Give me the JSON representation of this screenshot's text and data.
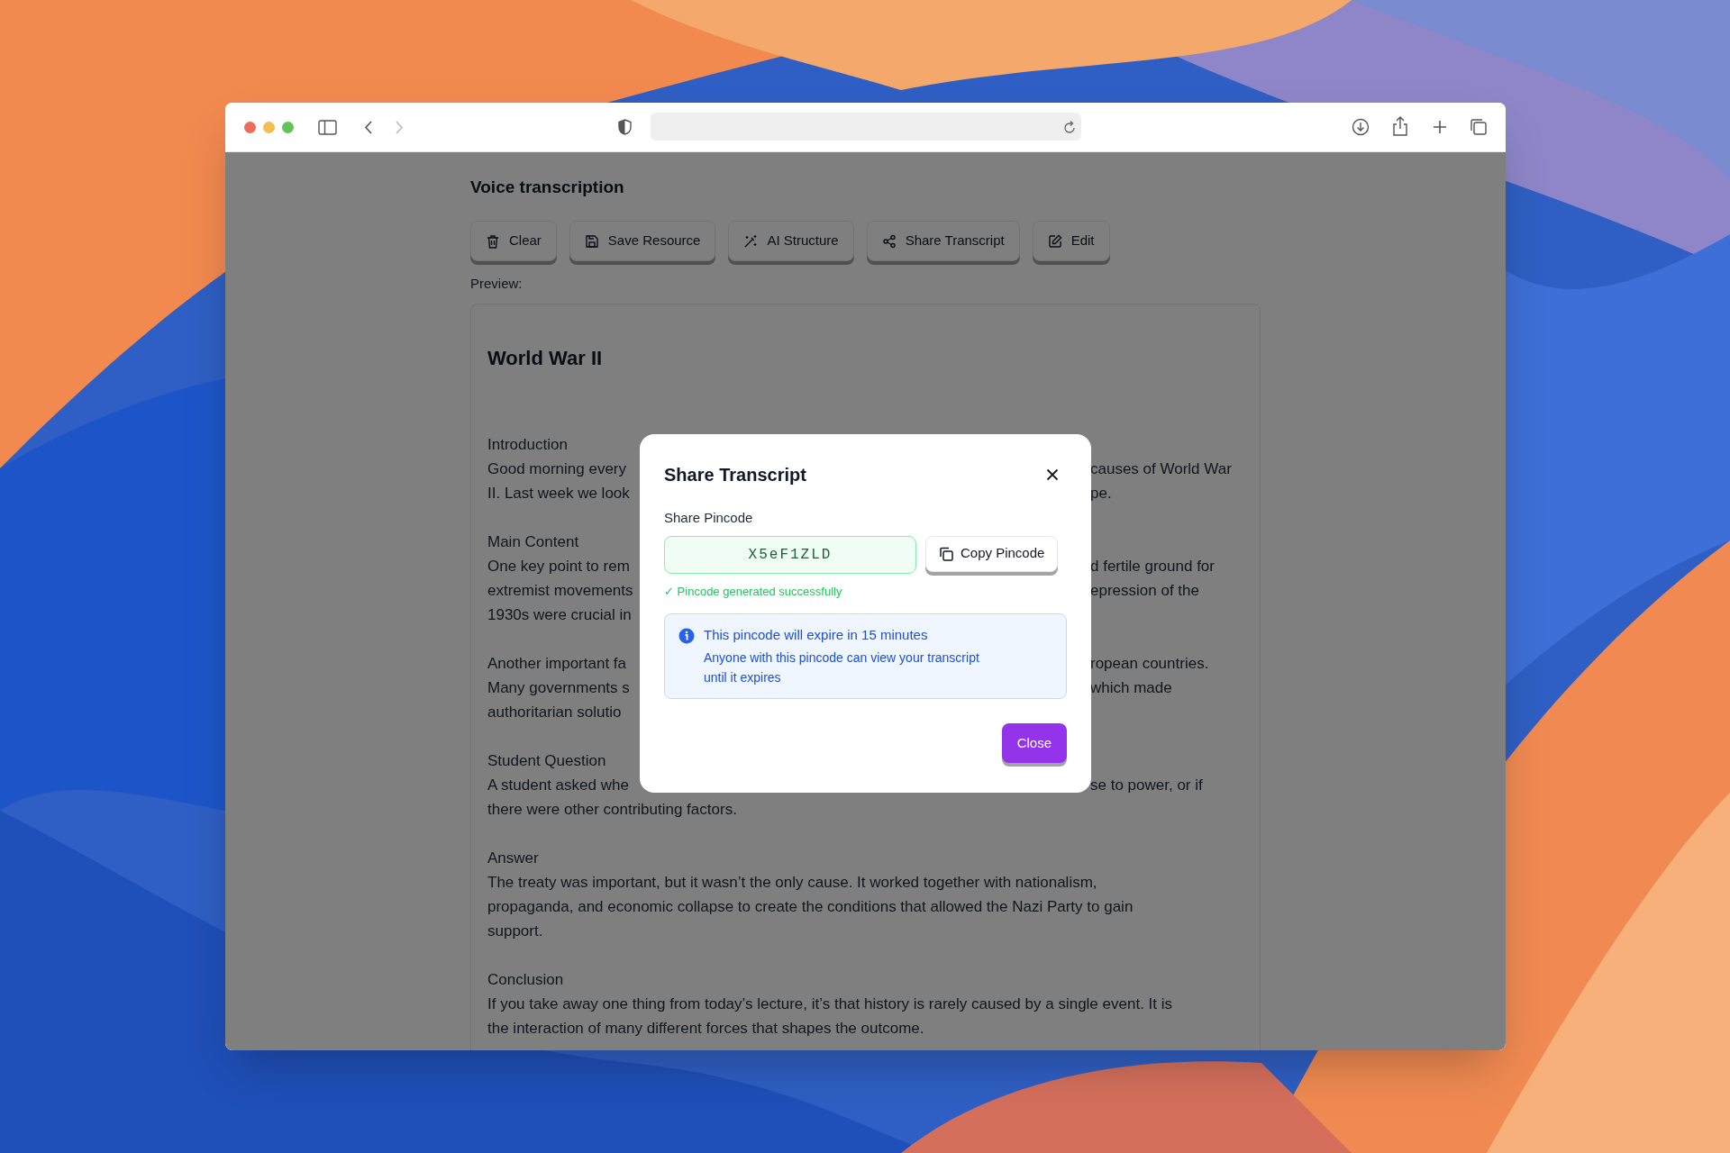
{
  "page": {
    "title": "Voice transcription",
    "toolbar_buttons": [
      {
        "label": "Clear"
      },
      {
        "label": "Save Resource"
      },
      {
        "label": "AI Structure"
      },
      {
        "label": "Share Transcript"
      },
      {
        "label": "Edit"
      }
    ],
    "preview_label": "Preview:",
    "preview": {
      "title": "World War II",
      "paragraphs": [
        [
          {
            "kind": "full",
            "text": "Introduction"
          },
          {
            "kind": "split",
            "left": "Good morning every",
            "right": "causes of World War"
          },
          {
            "kind": "split",
            "left": "II. Last week we look",
            "right": "pe."
          }
        ],
        [
          {
            "kind": "full",
            "text": "Main Content"
          },
          {
            "kind": "split",
            "left": "One key point to rem",
            "right": "d fertile ground for"
          },
          {
            "kind": "split",
            "left": "extremist movements",
            "right": "epression of the"
          },
          {
            "kind": "split",
            "left": "1930s were crucial in"
          }
        ],
        [
          {
            "kind": "split",
            "left": "Another important fa",
            "right": "ropean countries."
          },
          {
            "kind": "split",
            "left": "Many governments s",
            "right": "which made"
          },
          {
            "kind": "split",
            "left": "authoritarian solutio"
          }
        ],
        [
          {
            "kind": "full",
            "text": "Student Question"
          },
          {
            "kind": "split",
            "left": "A student asked whe",
            "right": "se to power, or if"
          },
          {
            "kind": "full",
            "text": "there were other contributing factors."
          }
        ],
        [
          {
            "kind": "full",
            "text": "Answer"
          },
          {
            "kind": "full",
            "text": "The treaty was important, but it wasn’t the only cause. It worked together with nationalism,"
          },
          {
            "kind": "full",
            "text": "propaganda, and economic collapse to create the conditions that allowed the Nazi Party to gain"
          },
          {
            "kind": "full",
            "text": "support."
          }
        ],
        [
          {
            "kind": "full",
            "text": "Conclusion"
          },
          {
            "kind": "full",
            "text": "If you take away one thing from today’s lecture, it’s that history is rarely caused by a single event. It is"
          },
          {
            "kind": "full",
            "text": "the interaction of many different forces that shapes the outcome."
          }
        ]
      ]
    }
  },
  "dialog": {
    "title": "Share Transcript",
    "field_label": "Share Pincode",
    "pincode": "X5eF1ZLD",
    "copy_button": "Copy Pincode",
    "success": "✓ Pincode generated successfully",
    "info": {
      "title": "This pincode will expire in 15 minutes",
      "body": "Anyone with this pincode can view your transcript until it expires"
    },
    "close_button": "Close"
  }
}
